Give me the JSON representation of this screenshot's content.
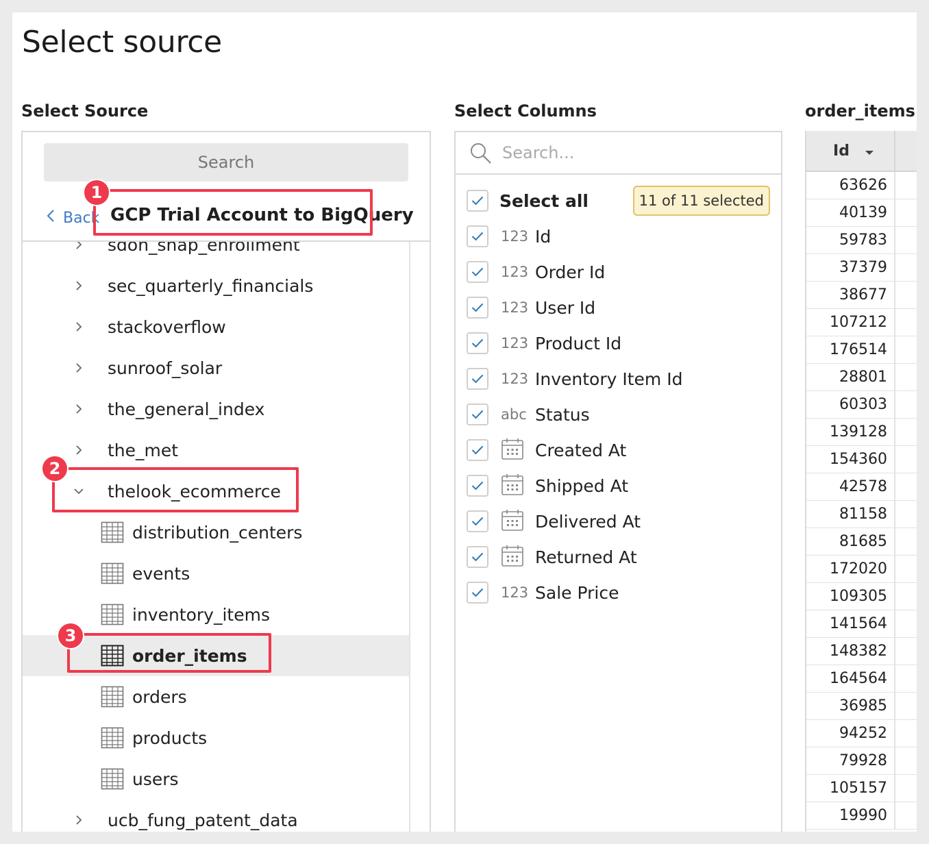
{
  "page": {
    "title": "Select source"
  },
  "sections": {
    "source_label": "Select Source",
    "columns_label": "Select Columns",
    "preview_label": "order_items"
  },
  "source": {
    "search_placeholder": "Search",
    "back_label": "Back",
    "connection_name": "GCP Trial Account to BigQuery",
    "items": [
      {
        "label": "sdoh_snap_enrollment",
        "kind": "dataset",
        "expanded": false
      },
      {
        "label": "sec_quarterly_financials",
        "kind": "dataset",
        "expanded": false
      },
      {
        "label": "stackoverflow",
        "kind": "dataset",
        "expanded": false
      },
      {
        "label": "sunroof_solar",
        "kind": "dataset",
        "expanded": false
      },
      {
        "label": "the_general_index",
        "kind": "dataset",
        "expanded": false
      },
      {
        "label": "the_met",
        "kind": "dataset",
        "expanded": false
      },
      {
        "label": "thelook_ecommerce",
        "kind": "dataset",
        "expanded": true
      },
      {
        "label": "distribution_centers",
        "kind": "table"
      },
      {
        "label": "events",
        "kind": "table"
      },
      {
        "label": "inventory_items",
        "kind": "table"
      },
      {
        "label": "order_items",
        "kind": "table",
        "selected": true
      },
      {
        "label": "orders",
        "kind": "table"
      },
      {
        "label": "products",
        "kind": "table"
      },
      {
        "label": "users",
        "kind": "table"
      },
      {
        "label": "ucb_fung_patent_data",
        "kind": "dataset",
        "expanded": false
      }
    ]
  },
  "columns": {
    "search_placeholder": "Search...",
    "select_all_label": "Select all",
    "selected_badge": "11 of 11 selected",
    "items": [
      {
        "type": "123",
        "label": "Id",
        "checked": true
      },
      {
        "type": "123",
        "label": "Order Id",
        "checked": true
      },
      {
        "type": "123",
        "label": "User Id",
        "checked": true
      },
      {
        "type": "123",
        "label": "Product Id",
        "checked": true
      },
      {
        "type": "123",
        "label": "Inventory Item Id",
        "checked": true
      },
      {
        "type": "abc",
        "label": "Status",
        "checked": true
      },
      {
        "type": "date",
        "label": "Created At",
        "checked": true
      },
      {
        "type": "date",
        "label": "Shipped At",
        "checked": true
      },
      {
        "type": "date",
        "label": "Delivered At",
        "checked": true
      },
      {
        "type": "date",
        "label": "Returned At",
        "checked": true
      },
      {
        "type": "123",
        "label": "Sale Price",
        "checked": true
      }
    ]
  },
  "preview": {
    "column_header": "Id",
    "values": [
      "63626",
      "40139",
      "59783",
      "37379",
      "38677",
      "107212",
      "176514",
      "28801",
      "60303",
      "139128",
      "154360",
      "42578",
      "81158",
      "81685",
      "172020",
      "109305",
      "141564",
      "148382",
      "164564",
      "36985",
      "94252",
      "79928",
      "105157",
      "19990"
    ]
  },
  "callouts": [
    {
      "number": "1",
      "target": "connection-name"
    },
    {
      "number": "2",
      "target": "thelook_ecommerce"
    },
    {
      "number": "3",
      "target": "order_items"
    }
  ],
  "colors": {
    "accent_red": "#ee3a4c",
    "check_blue": "#2f7ab8",
    "link_blue": "#3e7bc2",
    "badge_bg": "#fbf2cf",
    "badge_border": "#e0c36a"
  }
}
